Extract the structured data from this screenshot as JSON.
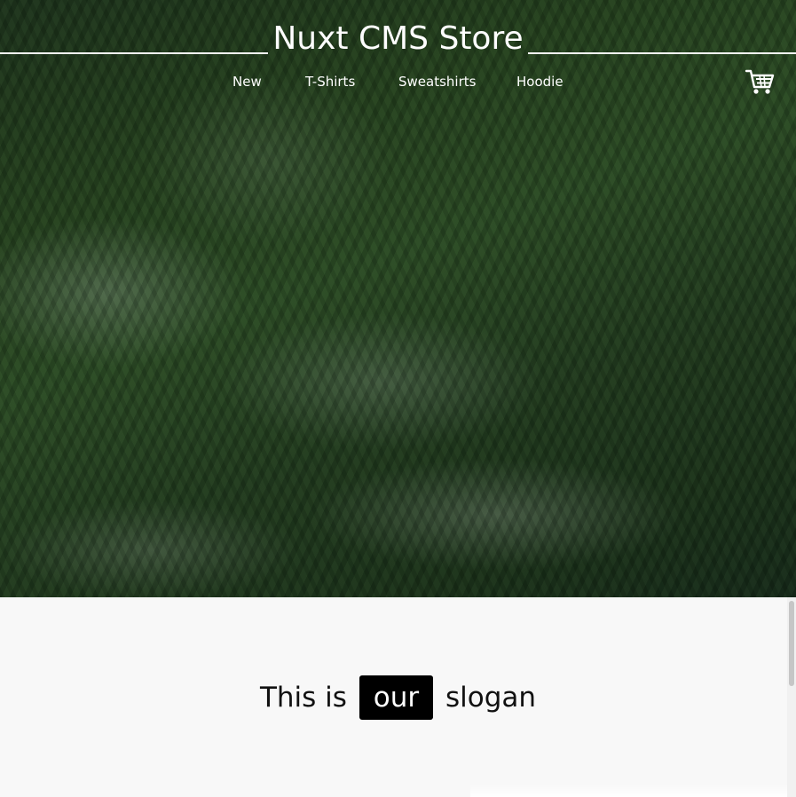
{
  "header": {
    "title": "Nuxt CMS Store"
  },
  "nav": {
    "items": [
      {
        "label": "New"
      },
      {
        "label": "T-Shirts"
      },
      {
        "label": "Sweatshirts"
      },
      {
        "label": "Hoodie"
      }
    ],
    "cart_icon": "shopping-cart-icon"
  },
  "hero": {
    "image": "misty-forest-background"
  },
  "slogan": {
    "before": "This is",
    "highlight": "our",
    "after": "slogan"
  },
  "colors": {
    "text_on_hero": "#ffffff",
    "slogan_text": "#111111",
    "highlight_bg": "#000000",
    "page_bg": "#f8f8f8"
  }
}
